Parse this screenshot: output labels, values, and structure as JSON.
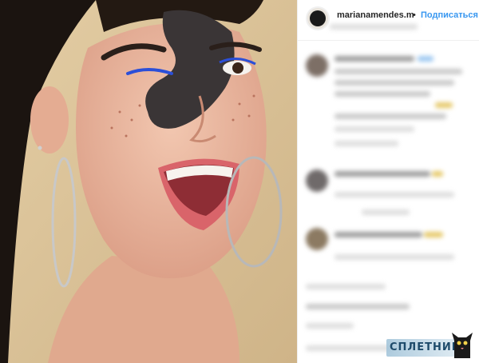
{
  "header": {
    "username": "marianamendes.m",
    "separator": "•",
    "follow_label": "Подписаться"
  },
  "watermark": {
    "text": "СПЛЕТНИК"
  },
  "colors": {
    "follow_blue": "#3897f0",
    "photo_background": "#d8bf95"
  },
  "icons": {
    "avatar": "profile-avatar",
    "watermark_mascot": "cat-icon"
  }
}
